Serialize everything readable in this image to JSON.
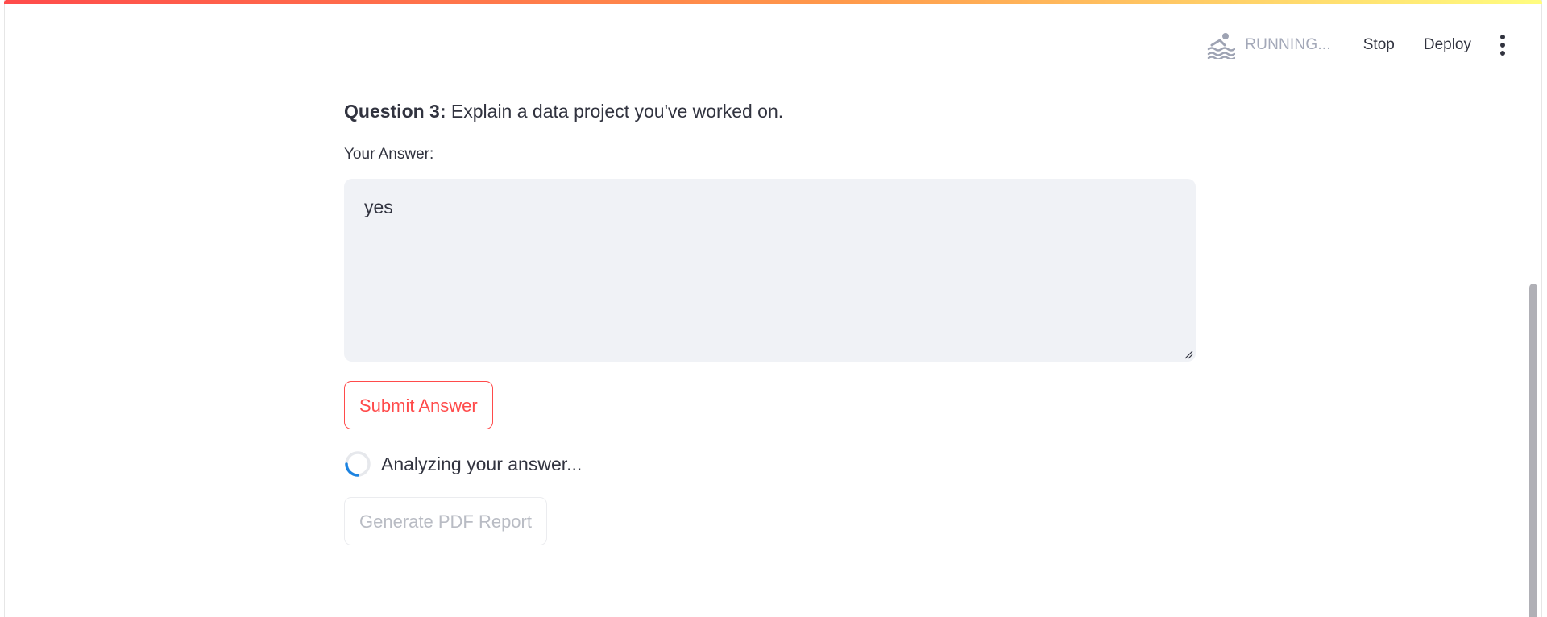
{
  "header": {
    "status_icon": "swimmer-icon",
    "status_text": "RUNNING...",
    "stop_label": "Stop",
    "deploy_label": "Deploy",
    "menu_icon": "vertical-dots-icon"
  },
  "main": {
    "question_prefix": "Question 3:",
    "question_text": " Explain a data project you've worked on.",
    "answer_label": "Your Answer:",
    "answer_value": "yes",
    "submit_label": "Submit Answer",
    "spinner_text": "Analyzing your answer...",
    "pdf_label": "Generate PDF Report"
  },
  "colors": {
    "accent": "#ff4b4b",
    "input_bg": "#f0f2f6",
    "spinner": "#1c83e1"
  }
}
